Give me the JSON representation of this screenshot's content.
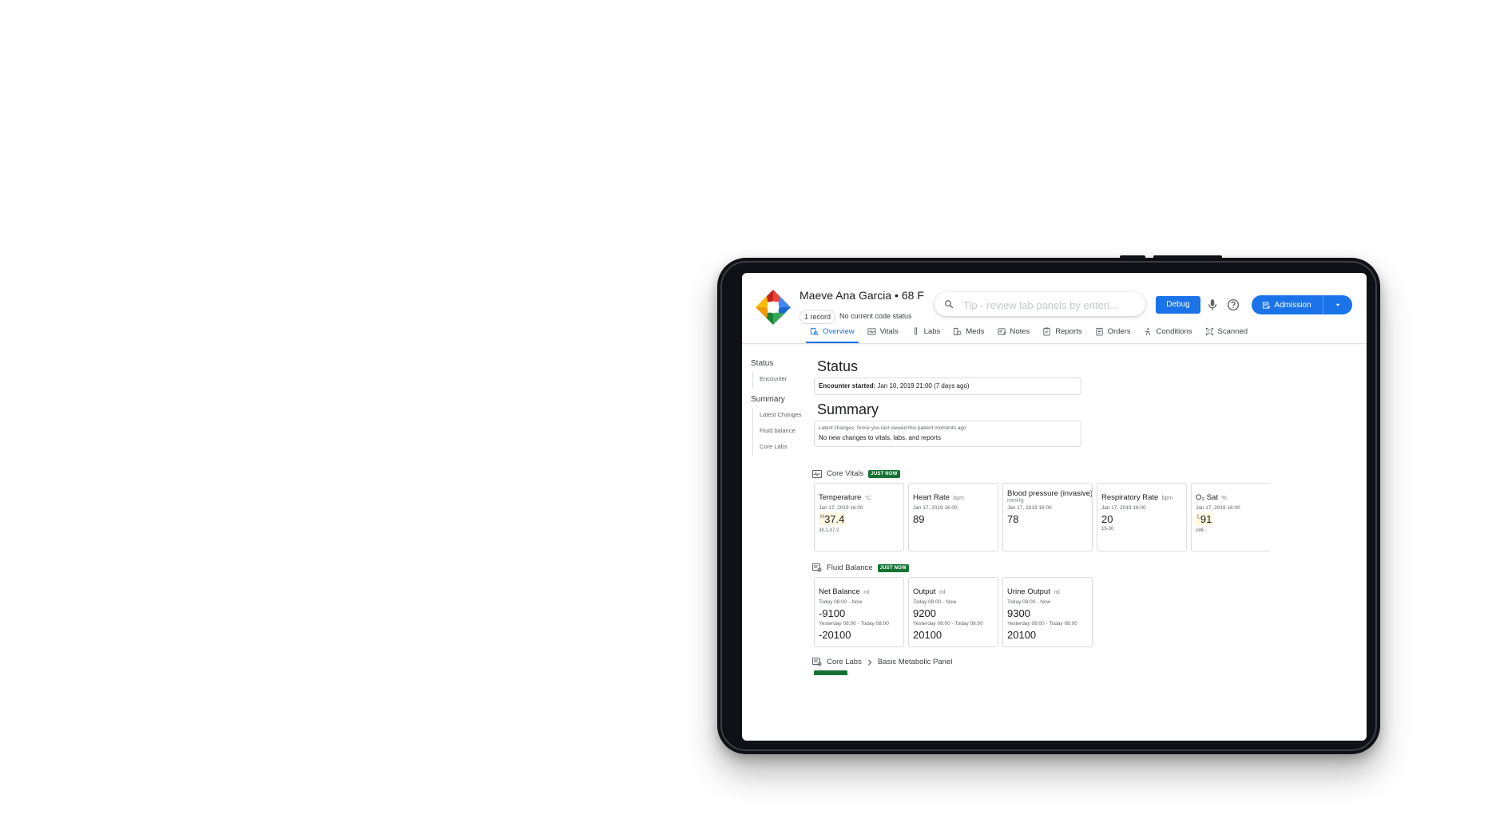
{
  "patient": {
    "name": "Maeve Ana Garcia • 68 F",
    "record_chip": "1 record",
    "code_status": "No current code status"
  },
  "search": {
    "placeholder": "Tip - review lab panels by enteri..."
  },
  "toolbar": {
    "debug_label": "Debug",
    "admission_label": "Admission"
  },
  "tabs": [
    {
      "label": "Overview",
      "icon": "overview-icon",
      "active": true
    },
    {
      "label": "Vitals",
      "icon": "vitals-icon"
    },
    {
      "label": "Labs",
      "icon": "labs-icon"
    },
    {
      "label": "Meds",
      "icon": "meds-icon"
    },
    {
      "label": "Notes",
      "icon": "notes-icon"
    },
    {
      "label": "Reports",
      "icon": "reports-icon"
    },
    {
      "label": "Orders",
      "icon": "orders-icon"
    },
    {
      "label": "Conditions",
      "icon": "conditions-icon"
    },
    {
      "label": "Scanned",
      "icon": "scanned-icon"
    }
  ],
  "sidenav": {
    "status_heading": "Status",
    "status_items": [
      "Encounter"
    ],
    "summary_heading": "Summary",
    "summary_items": [
      "Latest Changes",
      "Fluid balance",
      "Core Labs"
    ]
  },
  "status": {
    "title": "Status",
    "encounter_label": "Encounter started:",
    "encounter_value": "Jan 10, 2019 21:00 (7 days ago)"
  },
  "summary": {
    "title": "Summary",
    "latest_changes": "Latest changes: Since you last viewed this patient moments ago",
    "no_changes": "No new changes to vitals, labs, and reports"
  },
  "core_vitals": {
    "title": "Core Vitals",
    "badge": "JUST NOW",
    "cards": [
      {
        "title": "Temperature",
        "unit": "°C",
        "date": "Jan 17, 2019 16:00",
        "flag": "H",
        "value": "37.4",
        "range": "36.1-37.2"
      },
      {
        "title": "Heart Rate",
        "unit": "bpm",
        "date": "Jan 17, 2019 16:00",
        "flag": "",
        "value": "89",
        "range": ""
      },
      {
        "title": "Blood pressure (invasive)",
        "unit": "mmHg",
        "date": "Jan 17, 2019 16:00",
        "flag": "",
        "value": "78",
        "range": ""
      },
      {
        "title": "Respiratory Rate",
        "unit": "bpm",
        "date": "Jan 17, 2019 16:00",
        "flag": "",
        "value": "20",
        "range": "15-30"
      },
      {
        "title": "O₂ Sat",
        "unit": "%",
        "date": "Jan 17, 2019 16:00",
        "flag": "L",
        "value": "91",
        "range": "≥96"
      }
    ]
  },
  "fluid_balance": {
    "title": "Fluid Balance",
    "badge": "JUST NOW",
    "cards": [
      {
        "title": "Net Balance",
        "unit": "ml",
        "period1": "Today 08:00 - Now",
        "value1": "-9100",
        "period2": "Yesterday 08:00 - Today 08:00",
        "value2": "-20100"
      },
      {
        "title": "Output",
        "unit": "ml",
        "period1": "Today 08:00 - Now",
        "value1": "9200",
        "period2": "Yesterday 08:00 - Today 08:00",
        "value2": "20100"
      },
      {
        "title": "Urine Output",
        "unit": "ml",
        "period1": "Today 08:00 - Now",
        "value1": "9300",
        "period2": "Yesterday 08:00 - Today 08:00",
        "value2": "20100"
      }
    ]
  },
  "core_labs": {
    "title": "Core Labs",
    "panel": "Basic Metabolic Panel"
  },
  "colors": {
    "accent": "#1a73e8",
    "badge_green": "#137333",
    "flag_bg": "#fef7e0"
  }
}
